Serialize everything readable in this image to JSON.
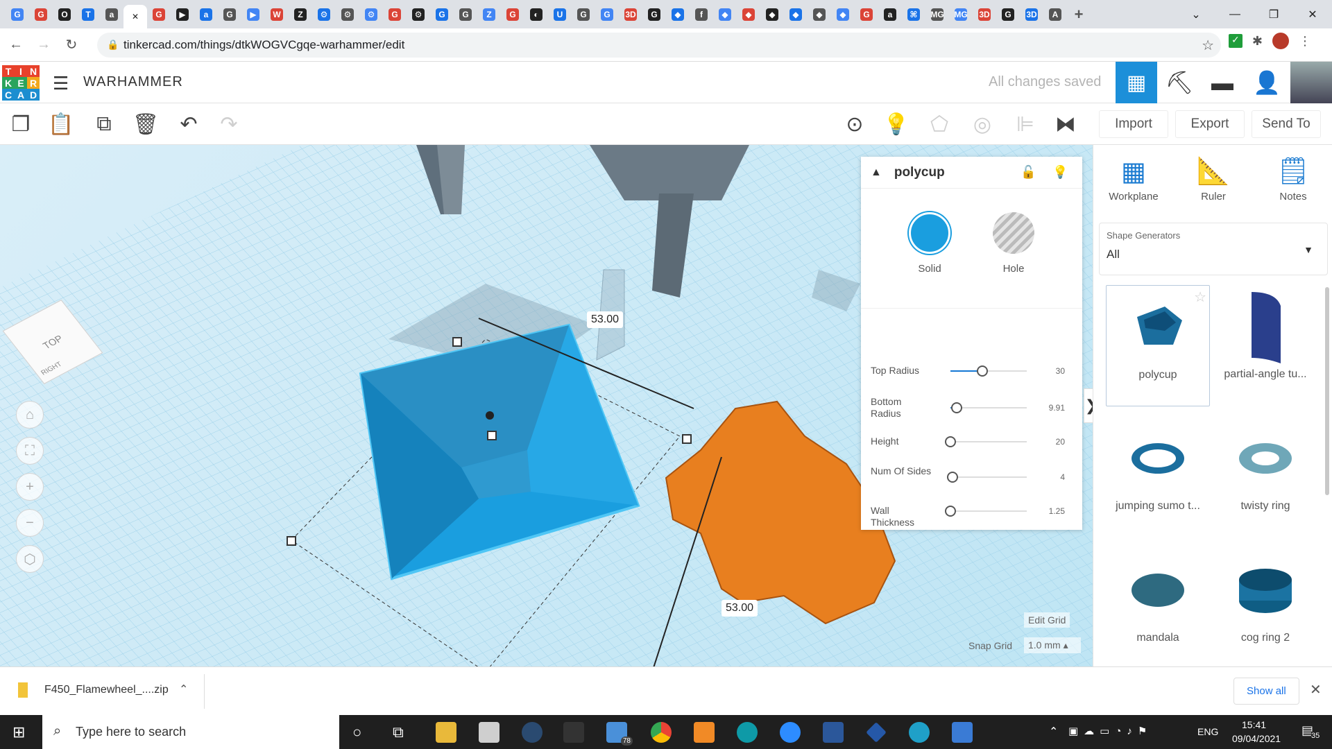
{
  "browser": {
    "url": "tinkercad.com/things/dtkWOGVCgqe-warhammer/edit",
    "tab_icons": [
      "G",
      "G",
      "O",
      "T",
      "a",
      "✕",
      "G",
      "▶",
      "a",
      "G",
      "▶",
      "W",
      "Z",
      "⚙",
      "⚙",
      "⚙",
      "G",
      "⚙",
      "G",
      "G",
      "Z",
      "G",
      "◐",
      "U",
      "G",
      "G",
      "3D",
      "G",
      "◆",
      "f",
      "◆",
      "◆",
      "◆",
      "◆",
      "◆",
      "◆",
      "G",
      "a",
      "⌘",
      "MG",
      "MG",
      "3D",
      "G",
      "3D",
      "A"
    ],
    "new_tab": "+"
  },
  "app": {
    "logo_letters": [
      "T",
      "I",
      "N",
      "K",
      "E",
      "R",
      "C",
      "A",
      "D"
    ],
    "logo_colors": [
      "#e8412b",
      "#e8412b",
      "#e8412b",
      "#2aa45c",
      "#2aa45c",
      "#f4a81c",
      "#1c8ed0",
      "#1c8ed0",
      "#1c8ed0"
    ],
    "title": "WARHAMMER",
    "save_status": "All changes saved"
  },
  "toolbar": {
    "import": "Import",
    "export": "Export",
    "send_to": "Send To"
  },
  "viewport": {
    "cube_top": "TOP",
    "cube_side": "RIGHT",
    "dim_top": "53.00",
    "dim_bottom": "53.00",
    "edit_grid": "Edit Grid",
    "snap_grid_label": "Snap Grid",
    "snap_grid_value": "1.0 mm"
  },
  "inspector": {
    "name": "polycup",
    "solid_label": "Solid",
    "hole_label": "Hole",
    "solid_color": "#1a9edf",
    "params": [
      {
        "label": "Top Radius",
        "value": "30",
        "level": 0.42
      },
      {
        "label": "Bottom Radius",
        "value": "9.91",
        "level": 0.08
      },
      {
        "label": "Height",
        "value": "20",
        "level": 0.0
      },
      {
        "label": "Num Of Sides",
        "value": "4",
        "level": 0.03
      },
      {
        "label": "Wall Thickness",
        "value": "1.25",
        "level": 0.0
      }
    ]
  },
  "sidebar": {
    "tools": [
      "Workplane",
      "Ruler",
      "Notes"
    ],
    "generators_label": "Shape Generators",
    "generators_value": "All",
    "shapes": [
      "polycup",
      "partial-angle tu...",
      "jumping sumo t...",
      "twisty ring",
      "mandala",
      "cog ring 2"
    ]
  },
  "downloads": {
    "file": "F450_Flamewheel_....zip",
    "show_all": "Show all"
  },
  "taskbar": {
    "search_placeholder": "Type here to search",
    "mail_badge": "78",
    "lang": "ENG",
    "time": "15:41",
    "date": "09/04/2021",
    "notif": "35"
  }
}
